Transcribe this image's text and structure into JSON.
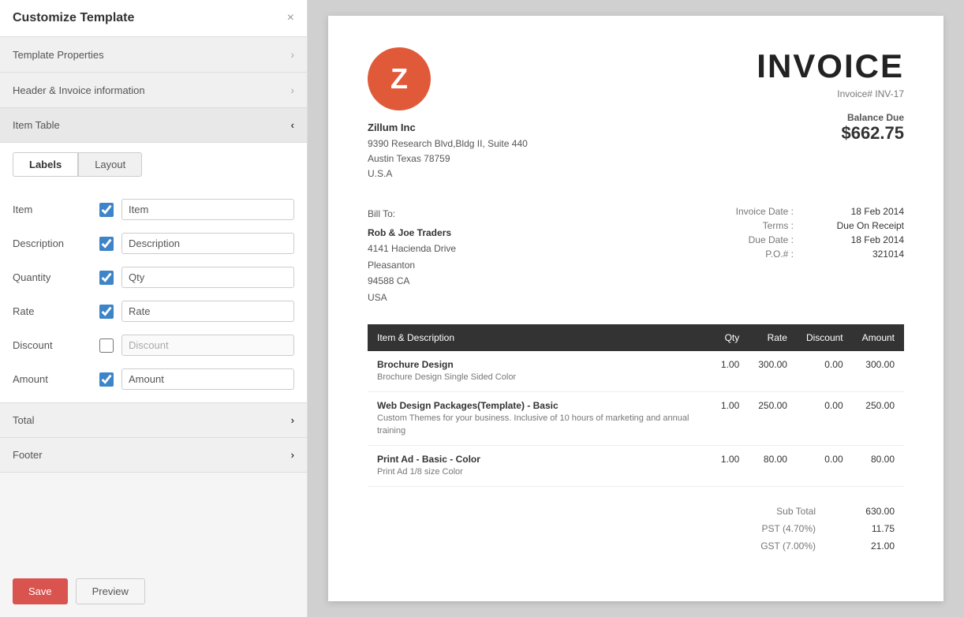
{
  "panel": {
    "title": "Customize Template",
    "close_label": "×",
    "sections": {
      "template_properties": "Template Properties",
      "header_invoice": "Header & Invoice information",
      "item_table": "Item Table",
      "total": "Total",
      "footer": "Footer"
    },
    "tabs": [
      {
        "id": "labels",
        "label": "Labels",
        "active": true
      },
      {
        "id": "layout",
        "label": "Layout",
        "active": false
      }
    ],
    "fields": [
      {
        "id": "item",
        "label": "Item",
        "checked": true,
        "value": "Item",
        "disabled": false
      },
      {
        "id": "description",
        "label": "Description",
        "checked": true,
        "value": "Description",
        "disabled": false
      },
      {
        "id": "quantity",
        "label": "Quantity",
        "checked": true,
        "value": "Qty",
        "disabled": false
      },
      {
        "id": "rate",
        "label": "Rate",
        "checked": true,
        "value": "Rate",
        "disabled": false
      },
      {
        "id": "discount",
        "label": "Discount",
        "checked": false,
        "value": "Discount",
        "disabled": true
      },
      {
        "id": "amount",
        "label": "Amount",
        "checked": true,
        "value": "Amount",
        "disabled": false
      }
    ],
    "buttons": {
      "save": "Save",
      "preview": "Preview"
    }
  },
  "invoice": {
    "company": {
      "logo_letter": "Z",
      "name": "Zillum Inc",
      "address_line1": "9390 Research Blvd,Bldg II, Suite 440",
      "address_line2": "Austin Texas 78759",
      "country": "U.S.A"
    },
    "title": "INVOICE",
    "invoice_number_label": "Invoice# INV-17",
    "balance_due_label": "Balance Due",
    "balance_due_amount": "$662.75",
    "bill_to_label": "Bill To:",
    "client": {
      "name": "Rob & Joe Traders",
      "address_line1": "4141 Hacienda Drive",
      "city": "Pleasanton",
      "postal_state": "94588 CA",
      "country": "USA"
    },
    "meta": [
      {
        "label": "Invoice Date :",
        "value": "18 Feb 2014"
      },
      {
        "label": "Terms :",
        "value": "Due On Receipt"
      },
      {
        "label": "Due Date :",
        "value": "18 Feb 2014"
      },
      {
        "label": "P.O.# :",
        "value": "321014"
      }
    ],
    "table": {
      "headers": [
        "Item & Description",
        "Qty",
        "Rate",
        "Discount",
        "Amount"
      ],
      "rows": [
        {
          "name": "Brochure Design",
          "description": "Brochure Design Single Sided Color",
          "qty": "1.00",
          "rate": "300.00",
          "discount": "0.00",
          "amount": "300.00"
        },
        {
          "name": "Web Design Packages(Template) - Basic",
          "description": "Custom Themes for your business. Inclusive of 10 hours of marketing and annual training",
          "qty": "1.00",
          "rate": "250.00",
          "discount": "0.00",
          "amount": "250.00"
        },
        {
          "name": "Print Ad - Basic - Color",
          "description": "Print Ad 1/8 size Color",
          "qty": "1.00",
          "rate": "80.00",
          "discount": "0.00",
          "amount": "80.00"
        }
      ]
    },
    "totals": [
      {
        "label": "Sub Total",
        "value": "630.00"
      },
      {
        "label": "PST (4.70%)",
        "value": "11.75"
      },
      {
        "label": "GST (7.00%)",
        "value": "21.00"
      }
    ]
  }
}
